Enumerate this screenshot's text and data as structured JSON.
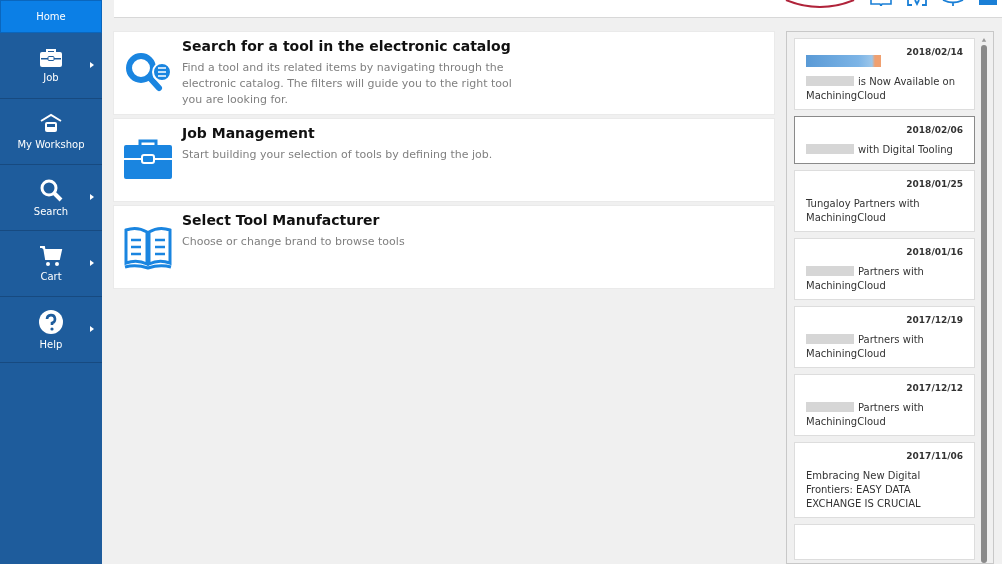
{
  "sidebar": {
    "items": [
      {
        "kind": "home",
        "label": "Home",
        "selected": true,
        "submenu": false
      },
      {
        "kind": "briefcase",
        "label": "Job",
        "selected": false,
        "submenu": true
      },
      {
        "kind": "workshop",
        "label": "My Workshop",
        "selected": false,
        "submenu": false
      },
      {
        "kind": "search",
        "label": "Search",
        "selected": false,
        "submenu": true
      },
      {
        "kind": "cart",
        "label": "Cart",
        "selected": false,
        "submenu": true
      },
      {
        "kind": "help",
        "label": "Help",
        "selected": false,
        "submenu": true
      }
    ]
  },
  "actions": [
    {
      "kind": "search",
      "title": "Search for a tool in the electronic catalog",
      "description": "Find a tool and its related items by navigating through the electronic catalog. The filters will guide you to the right tool you are looking for."
    },
    {
      "kind": "briefcase",
      "title": "Job Management",
      "description": "Start building your selection of tools by defining the job."
    },
    {
      "kind": "book",
      "title": "Select Tool Manufacturer",
      "description": "Choose or change brand to browse tools"
    }
  ],
  "news": [
    {
      "date": "2018/02/14",
      "banner": true,
      "redacted": true,
      "text": "is Now Available on MachiningCloud",
      "selected": false
    },
    {
      "date": "2018/02/06",
      "banner": false,
      "redacted": true,
      "text": "with Digital Tooling",
      "selected": true
    },
    {
      "date": "2018/01/25",
      "banner": false,
      "redacted": false,
      "text": "Tungaloy Partners with MachiningCloud",
      "selected": false
    },
    {
      "date": "2018/01/16",
      "banner": false,
      "redacted": true,
      "text": "Partners with MachiningCloud",
      "selected": false
    },
    {
      "date": "2017/12/19",
      "banner": false,
      "redacted": true,
      "text": "Partners with MachiningCloud",
      "selected": false
    },
    {
      "date": "2017/12/12",
      "banner": false,
      "redacted": true,
      "text": "Partners with MachiningCloud",
      "selected": false
    },
    {
      "date": "2017/11/06",
      "banner": false,
      "redacted": false,
      "text": "Embracing New Digital Frontiers: EASY DATA EXCHANGE IS CRUCIAL",
      "selected": false
    }
  ]
}
